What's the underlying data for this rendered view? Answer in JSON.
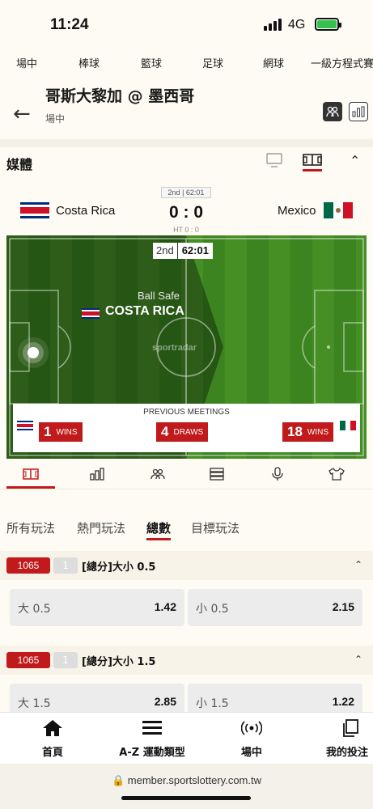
{
  "status_bar": {
    "time": "11:24",
    "network": "4G"
  },
  "sport_nav": [
    "場中",
    "棒球",
    "籃球",
    "足球",
    "網球",
    "一級方程式賽"
  ],
  "header": {
    "title": "哥斯大黎加 @ 墨西哥",
    "subtitle": "場中"
  },
  "media": {
    "title": "媒體"
  },
  "match": {
    "period": "2nd | 62:01",
    "home_team": "Costa Rica",
    "away_team": "Mexico",
    "score": "0 : 0",
    "half_time": "HT 0 : 0"
  },
  "pitch": {
    "clock_period": "2nd",
    "clock_time": "62:01",
    "event": "Ball Safe",
    "event_team": "COSTA RICA",
    "watermark": "sportradar",
    "meetings": {
      "heading": "PREVIOUS MEETINGS",
      "home_wins": "1",
      "home_wins_label": "WINS",
      "draws": "4",
      "draws_label": "DRAWS",
      "away_wins": "18",
      "away_wins_label": "WINS"
    }
  },
  "bet_tabs": [
    "所有玩法",
    "熱門玩法",
    "總數",
    "目標玩法"
  ],
  "markets": [
    {
      "id": "1065",
      "num": "1",
      "name": "[總分]大小 0.5",
      "options": [
        {
          "label": "大 0.5",
          "odds": "1.42"
        },
        {
          "label": "小 0.5",
          "odds": "2.15"
        }
      ]
    },
    {
      "id": "1065",
      "num": "1",
      "name": "[總分]大小 1.5",
      "options": [
        {
          "label": "大 1.5",
          "odds": "2.85"
        },
        {
          "label": "小 1.5",
          "odds": "1.22"
        }
      ]
    }
  ],
  "bottom_nav": [
    "首頁",
    "A-Z 運動類型",
    "場中",
    "我的投注"
  ],
  "url": "member.sportslottery.com.tw",
  "colors": {
    "accent": "#c01a1c",
    "pitch": "#3f8a22",
    "background": "#fdfbf3"
  }
}
